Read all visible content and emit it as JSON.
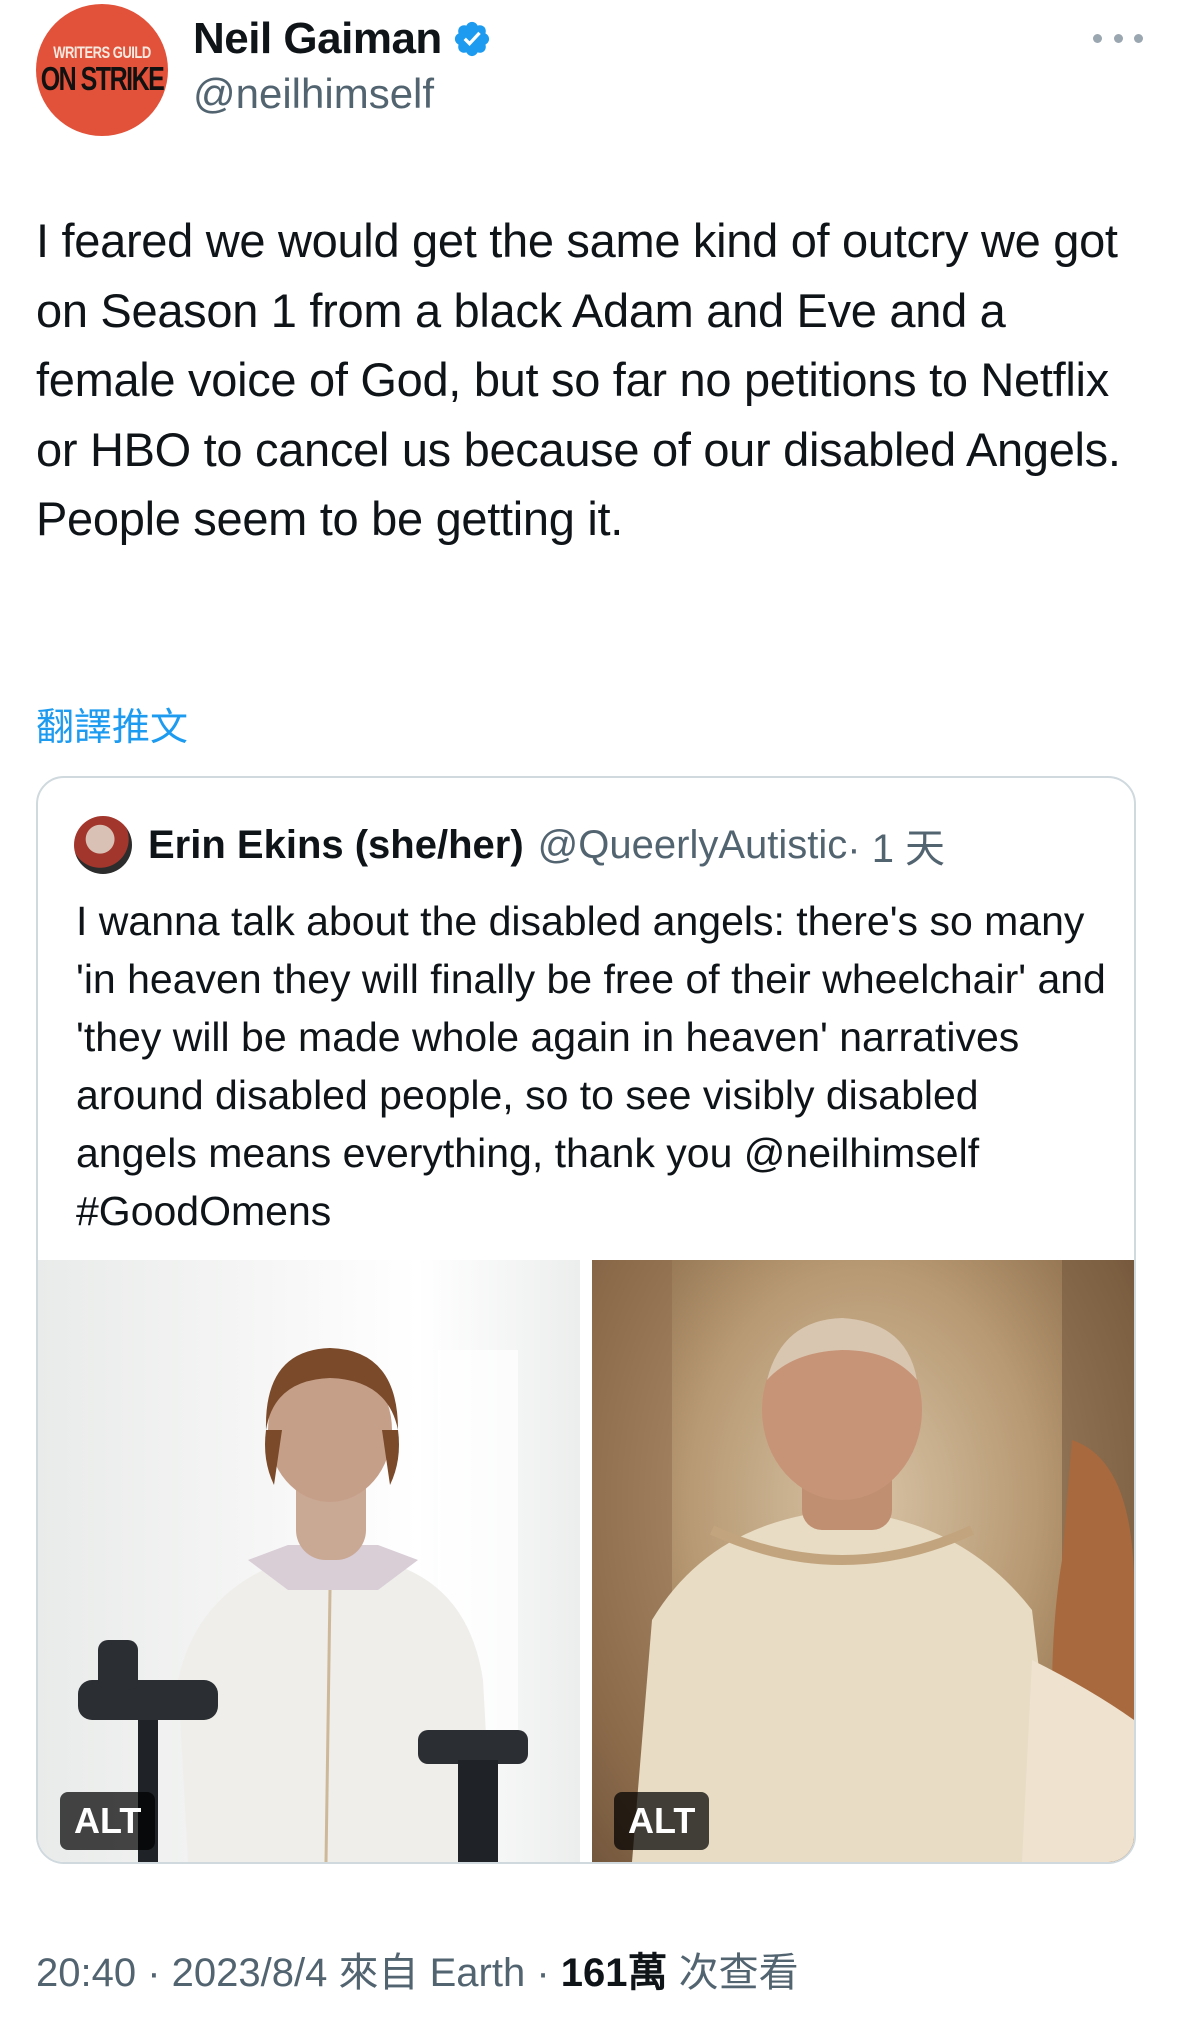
{
  "author": {
    "avatar_text_line1": "WRITERS GUILD",
    "avatar_text_line2": "ON STRIKE",
    "display_name": "Neil Gaiman",
    "handle": "@neilhimself",
    "verified": true
  },
  "tweet": {
    "text": "I feared we would get the same kind of outcry we got on Season 1 from a black Adam and Eve and a female voice of God, but so far no petitions to Netflix or HBO to cancel us because of our disabled Angels. People seem to be getting it.",
    "translate_label": "翻譯推文"
  },
  "quote": {
    "display_name": "Erin Ekins (she/her)",
    "handle": "@QueerlyAutistic",
    "time": "· 1 天",
    "text": "I wanna talk about the disabled angels: there's so many 'in heaven they will finally be free of their wheelchair' and 'they will be made whole again in heaven' narratives around disabled people, so to see visibly disabled angels means everything, thank you @neilhimself #GoodOmens",
    "media": [
      {
        "alt_label": "ALT"
      },
      {
        "alt_label": "ALT"
      }
    ]
  },
  "meta": {
    "time": "20:40",
    "sep1": " · ",
    "date": "2023/8/4",
    "source": " 來自 Earth",
    "sep2": " · ",
    "views_count": "161萬",
    "views_label": " 次查看"
  },
  "colors": {
    "link": "#1d9bf0",
    "secondary_text": "#536471",
    "verified_badge": "#1d9bf0",
    "border": "#cfd9de"
  },
  "icons": {
    "verified": "verified-badge-icon",
    "more": "more-horizontal-icon"
  }
}
